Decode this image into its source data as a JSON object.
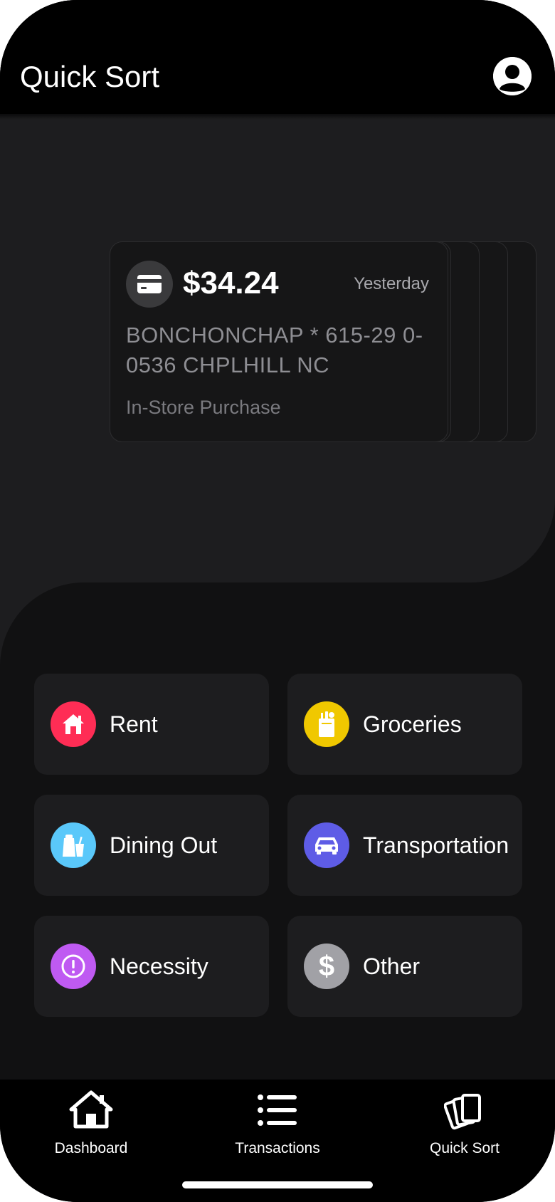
{
  "header": {
    "title": "Quick Sort"
  },
  "card": {
    "amount": "$34.24",
    "date": "Yesterday",
    "merchant": "BONCHONCHAP * 615-29 0-0536 CHPLHILL NC",
    "type": "In-Store Purchase",
    "icon": "credit-card-icon"
  },
  "categories": [
    {
      "label": "Rent",
      "icon": "house-icon",
      "color": "#ff2d55"
    },
    {
      "label": "Groceries",
      "icon": "grocery-bag-icon",
      "color": "#f0c800"
    },
    {
      "label": "Dining Out",
      "icon": "takeout-icon",
      "color": "#5ac8fa"
    },
    {
      "label": "Transportation",
      "icon": "car-icon",
      "color": "#5e5ce6"
    },
    {
      "label": "Necessity",
      "icon": "exclamation-icon",
      "color": "#bf5af2"
    },
    {
      "label": "Other",
      "icon": "dollar-icon",
      "color": "#a1a1a6"
    }
  ],
  "tabs": [
    {
      "label": "Dashboard",
      "icon": "home-icon"
    },
    {
      "label": "Transactions",
      "icon": "list-icon"
    },
    {
      "label": "Quick Sort",
      "icon": "stack-icon"
    }
  ]
}
